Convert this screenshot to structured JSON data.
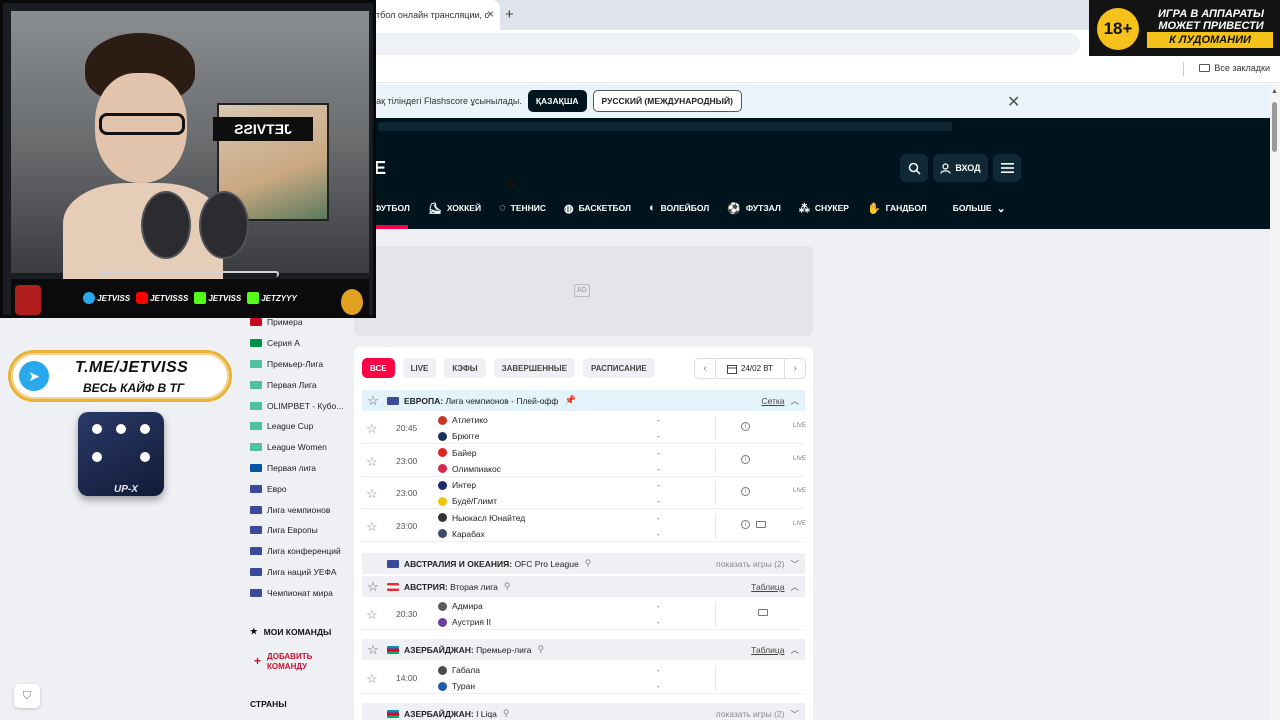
{
  "browser": {
    "tab_title": "тбол онлайн трансляции, с",
    "new_tab": "+",
    "bookmarks_label": "Все закладки"
  },
  "lang_bar": {
    "text": "зақ тіліндегі Flashscore ұсынылады.",
    "kaz_button": "ҚАЗАҚША",
    "rus_button": "РУССКИЙ (МЕЖДУНАРОДНЫЙ)"
  },
  "header": {
    "logo_fragment": "E",
    "login_label": "ВХОД",
    "sports": [
      {
        "label": "ФУТБОЛ",
        "icon": "soccer-icon"
      },
      {
        "label": "ХОККЕЙ",
        "icon": "hockey-icon"
      },
      {
        "label": "ТЕННИС",
        "icon": "tennis-icon"
      },
      {
        "label": "БАСКЕТБОЛ",
        "icon": "basketball-icon"
      },
      {
        "label": "ВОЛЕЙБОЛ",
        "icon": "volleyball-icon"
      },
      {
        "label": "ФУТЗАЛ",
        "icon": "futsal-icon"
      },
      {
        "label": "СНУКЕР",
        "icon": "snooker-icon"
      },
      {
        "label": "ГАНДБОЛ",
        "icon": "handball-icon"
      }
    ],
    "more_label": "БОЛЬШЕ"
  },
  "stream": {
    "social": [
      "JETVISS",
      "JETVISSS",
      "JETVISS",
      "JETZYYY"
    ],
    "sign": "JETVISS",
    "tg_line1": "T.ME/JETVISS",
    "tg_line2": "ВЕСЬ КАЙФ В ТГ",
    "dice_label": "UP-X",
    "age_number": "18+",
    "age_line1": "ИГРА В АППАРАТЫ",
    "age_line2": "МОЖЕТ ПРИВЕСТИ",
    "age_line3": "К ЛУДОМАНИИ"
  },
  "leftnav": {
    "items": [
      {
        "label": "Примера",
        "flag": "#c60b1e"
      },
      {
        "label": "Серия А",
        "flag": "#009246"
      },
      {
        "label": "Премьер-Лига",
        "flag": "#4fc3a1"
      },
      {
        "label": "Первая Лига",
        "flag": "#4fc3a1"
      },
      {
        "label": "OLIMPBET - Кубо...",
        "flag": "#4fc3a1"
      },
      {
        "label": "League Cup",
        "flag": "#4fc3a1"
      },
      {
        "label": "League Women",
        "flag": "#4fc3a1"
      },
      {
        "label": "Первая лига",
        "flag": "#0055a4"
      },
      {
        "label": "Евро",
        "flag": "#3b4a9a"
      },
      {
        "label": "Лига чемпионов",
        "flag": "#3b4a9a"
      },
      {
        "label": "Лига Европы",
        "flag": "#3b4a9a"
      },
      {
        "label": "Лига конференций",
        "flag": "#3b4a9a"
      },
      {
        "label": "Лига наций УЕФА",
        "flag": "#3b4a9a"
      },
      {
        "label": "Чемпионат мира",
        "flag": "#3b4a9a"
      }
    ],
    "my_teams": "МОИ КОМАНДЫ",
    "add_team_1": "ДОБАВИТЬ",
    "add_team_2": "КОМАНДУ",
    "countries": "СТРАНЫ"
  },
  "ad": {
    "label": "AD"
  },
  "filters": {
    "all": "ВСЕ",
    "live": "LIVE",
    "odds": "КЭФЫ",
    "finished": "ЗАВЕРШЕННЫЕ",
    "schedule": "РАСПИСАНИЕ",
    "date": "24/02 ВТ"
  },
  "leagues": {
    "cl": {
      "country": "ЕВРОПА:",
      "name": "Лига чемпионов - Плей-офф",
      "link": "Сетка"
    },
    "ofc": {
      "country": "АВСТРАЛИЯ И ОКЕАНИЯ:",
      "name": "OFC Pro League",
      "link": "показать игры (2)"
    },
    "aut": {
      "country": "АВСТРИЯ:",
      "name": "Вторая лига",
      "link": "Таблица"
    },
    "aze": {
      "country": "АЗЕРБАЙДЖАН:",
      "name": "Премьер-лига",
      "link": "Таблица"
    },
    "aze2": {
      "country": "АЗЕРБАЙДЖАН:",
      "name": "I Liqa",
      "link": "показать игры (2)"
    }
  },
  "matches": {
    "cl": [
      {
        "time": "20:45",
        "home": "Атлетико",
        "away": "Брюгге",
        "hs": "-",
        "as": "-",
        "home_color": "#cb3524",
        "away_color": "#1b2f5e",
        "live": "LIVE"
      },
      {
        "time": "23:00",
        "home": "Байер",
        "away": "Олимпиакос",
        "hs": "-",
        "as": "-",
        "home_color": "#e32221",
        "away_color": "#d9254a",
        "live": "LIVE"
      },
      {
        "time": "23:00",
        "home": "Интер",
        "away": "Будё/Глимт",
        "hs": "-",
        "as": "-",
        "home_color": "#1e2b6b",
        "away_color": "#f1c40f",
        "live": "LIVE"
      },
      {
        "time": "23:00",
        "home": "Ньюкасл Юнайтед",
        "away": "Карабах",
        "hs": "-",
        "as": "-",
        "home_color": "#333333",
        "away_color": "#3a4a6b",
        "live": "LIVE"
      }
    ],
    "aut": [
      {
        "time": "20:30",
        "home": "Адмира",
        "away": "Аустрия II",
        "hs": "-",
        "as": "-",
        "home_color": "#5a5a5a",
        "away_color": "#6b3fa0"
      }
    ],
    "aze": [
      {
        "time": "14:00",
        "home": "Габала",
        "away": "Туран",
        "hs": "-",
        "as": "-",
        "home_color": "#4a4a4a",
        "away_color": "#1e5aa8"
      }
    ]
  }
}
